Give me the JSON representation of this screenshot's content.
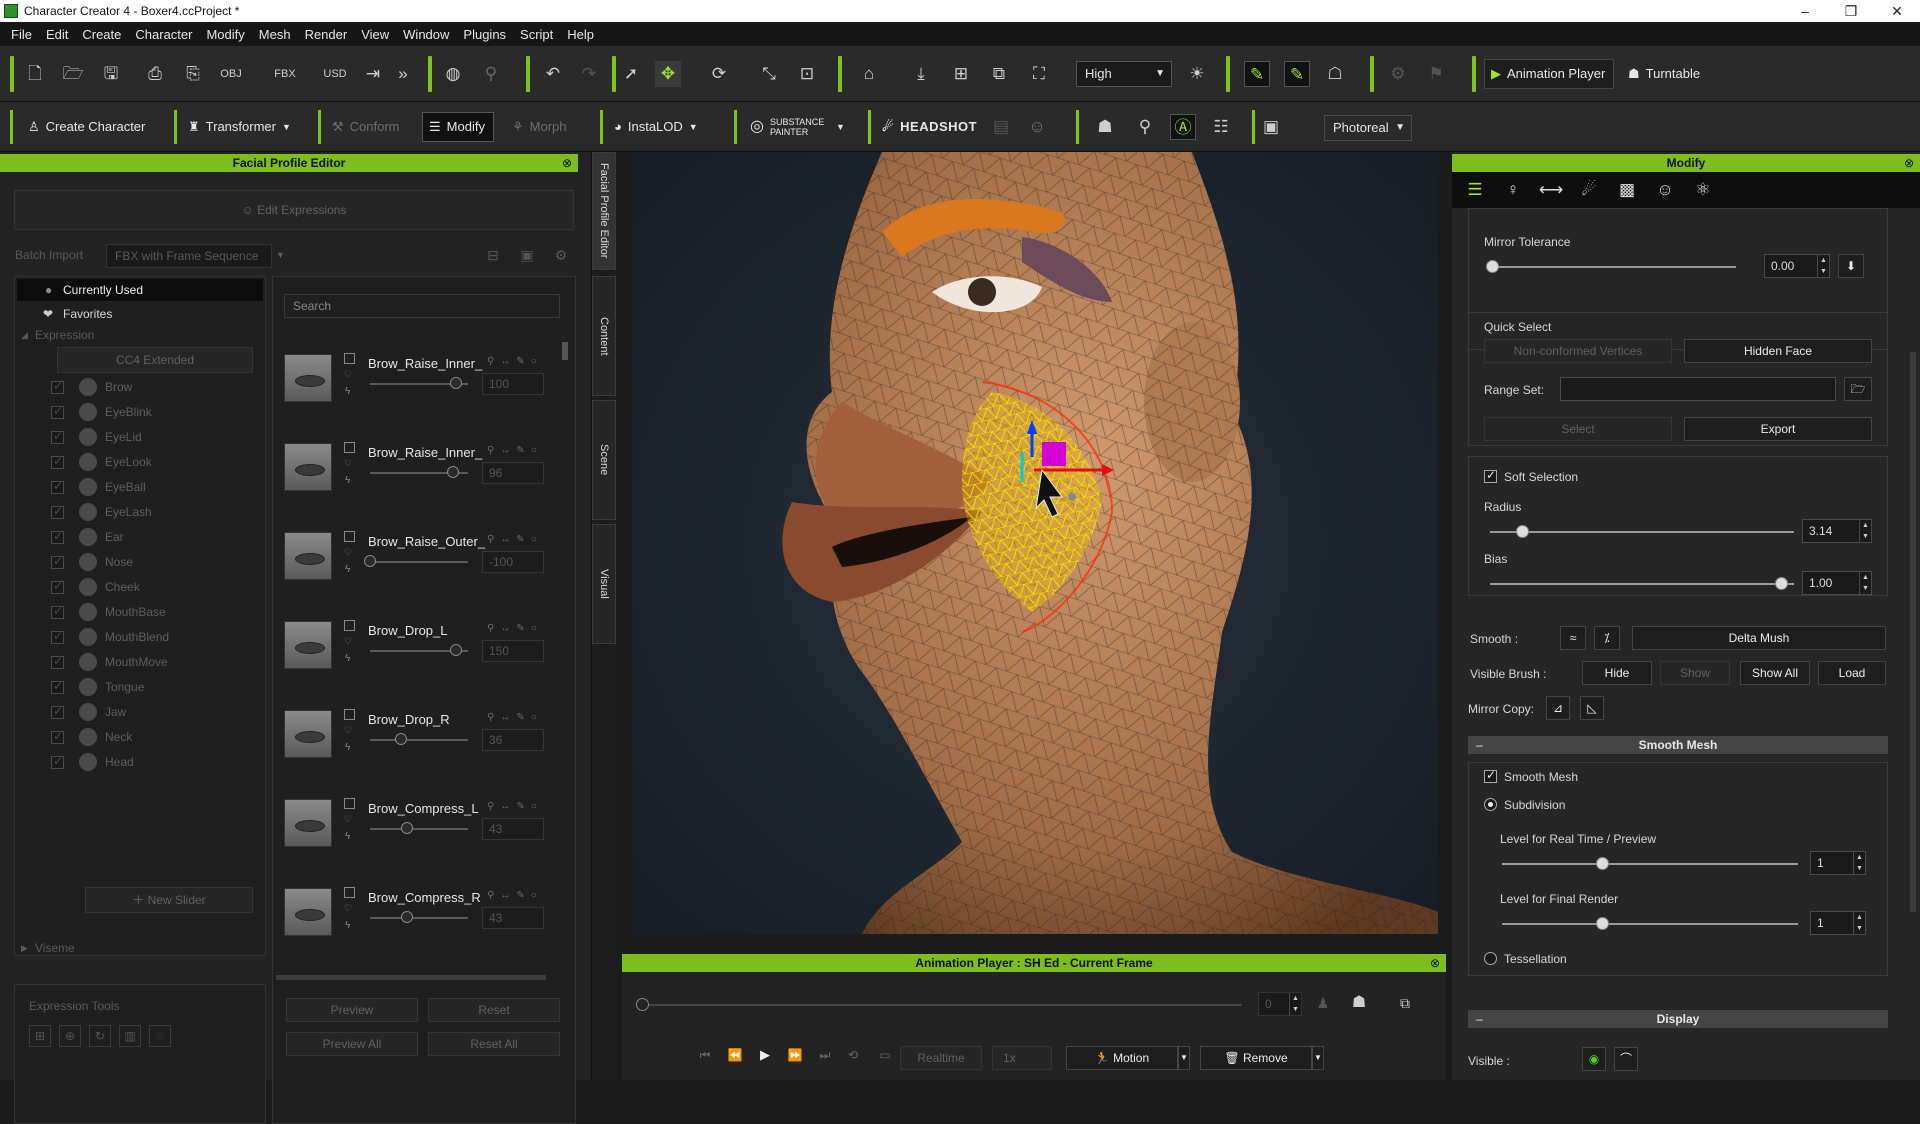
{
  "window": {
    "title": "Character Creator 4 - Boxer4.ccProject *",
    "controls": [
      "–",
      "❐",
      "✕"
    ]
  },
  "menu": [
    "File",
    "Edit",
    "Create",
    "Character",
    "Modify",
    "Mesh",
    "Render",
    "View",
    "Window",
    "Plugins",
    "Script",
    "Help"
  ],
  "toolbar1": {
    "quality": "High",
    "animation_player": "Animation Player",
    "turntable": "Turntable"
  },
  "toolbar2": {
    "create_character": "Create Character",
    "transformer": "Transformer",
    "conform": "Conform",
    "modify": "Modify",
    "morph": "Morph",
    "instalod": "InstaLOD",
    "substance": "SUBSTANCE PAINTER",
    "headshot": "HEADSHOT",
    "render_mode": "Photoreal"
  },
  "left": {
    "title": "Facial Profile Editor",
    "edit_expressions": "Edit Expressions",
    "batch_import_label": "Batch Import",
    "batch_import_value": "FBX with Frame Sequence",
    "tree": {
      "currently_used": "Currently Used",
      "favorites": "Favorites",
      "expression": "Expression",
      "profile": "CC4 Extended",
      "categories": [
        "Brow",
        "EyeBlink",
        "EyeLid",
        "EyeLook",
        "EyeBall",
        "EyeLash",
        "Ear",
        "Nose",
        "Cheek",
        "MouthBase",
        "MouthBlend",
        "MouthMove",
        "Tongue",
        "Jaw",
        "Neck",
        "Head"
      ],
      "new_slider": "New Slider",
      "viseme": "Viseme"
    },
    "search_placeholder": "Search",
    "expressions": [
      {
        "name": "Brow_Raise_Inner_",
        "value": "100",
        "knob": 1.0
      },
      {
        "name": "Brow_Raise_Inner_",
        "value": "96",
        "knob": 0.96
      },
      {
        "name": "Brow_Raise_Outer_",
        "value": "-100",
        "knob": 0.0
      },
      {
        "name": "Brow_Drop_L",
        "value": "150",
        "knob": 1.0
      },
      {
        "name": "Brow_Drop_R",
        "value": "36",
        "knob": 0.36
      },
      {
        "name": "Brow_Compress_L",
        "value": "43",
        "knob": 0.43
      },
      {
        "name": "Brow_Compress_R",
        "value": "43",
        "knob": 0.43
      }
    ],
    "expression_tools": "Expression Tools",
    "preview": "Preview",
    "reset": "Reset",
    "preview_all": "Preview All",
    "reset_all": "Reset All"
  },
  "vtabs": [
    "Facial Profile Editor",
    "Content",
    "Scene",
    "Visual"
  ],
  "anim": {
    "title": "Animation Player : SH Ed - Current Frame",
    "frame": "0",
    "realtime": "Realtime",
    "speed": "1x",
    "motion": "Motion",
    "remove": "Remove"
  },
  "right": {
    "title": "Modify",
    "mirror_tolerance": "Mirror Tolerance",
    "mirror_tolerance_value": "0.00",
    "quick_select": "Quick Select",
    "non_conformed": "Non-conformed Vertices",
    "hidden_face": "Hidden Face",
    "range_set": "Range Set:",
    "select": "Select",
    "export": "Export",
    "soft_selection": "Soft Selection",
    "radius": "Radius",
    "radius_value": "3.14",
    "bias": "Bias",
    "bias_value": "1.00",
    "smooth": "Smooth :",
    "delta_mush": "Delta Mush",
    "visible_brush": "Visible Brush :",
    "hide": "Hide",
    "show": "Show",
    "show_all": "Show All",
    "load": "Load",
    "mirror_copy": "Mirror Copy:",
    "smooth_mesh_header": "Smooth Mesh",
    "smooth_mesh": "Smooth Mesh",
    "subdivision": "Subdivision",
    "level_realtime": "Level for Real Time / Preview",
    "level_realtime_value": "1",
    "level_final": "Level for Final Render",
    "level_final_value": "1",
    "tessellation": "Tessellation",
    "display_header": "Display",
    "visible": "Visible :"
  },
  "colors": {
    "accent": "#7dbe1e",
    "bg": "#232323"
  }
}
